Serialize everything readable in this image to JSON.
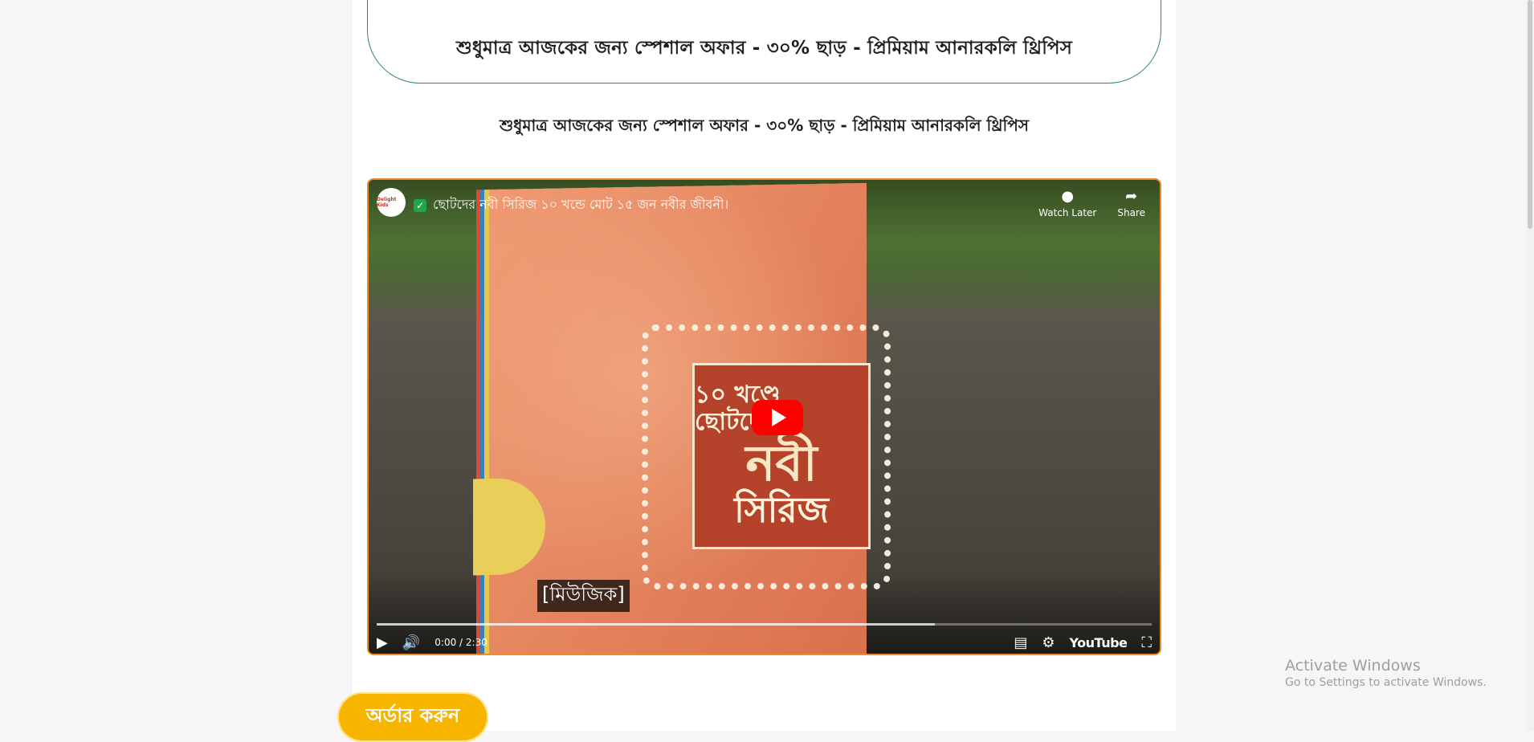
{
  "page": {
    "banner_title": "শুধুমাত্র আজকের জন্য স্পেশাল অফার - ৩০% ছাড় - প্রিমিয়াম আনারকলি থ্রিপিস",
    "subheading": "শুধুমাত্র আজকের জন্য স্পেশাল অফার - ৩০% ছাড় - প্রিমিয়াম আনারকলি থ্রিপিস",
    "order_button": "অর্ডার করুন"
  },
  "video": {
    "channel_logo": "Delight Kids",
    "title": "ছোটদের নবী সিরিজ ১০ খন্ডে মোট ১৫ জন নবীর জীবনী।",
    "watch_later_label": "Watch Later",
    "share_label": "Share",
    "caption": "[মিউজিক]",
    "time": "0:00 / 2:30",
    "buffered_fraction": 0.72,
    "youtube_label": "YouTube",
    "cover_text": {
      "line1": "১০ খণ্ডে ছোটদের",
      "line2": "নবী",
      "line3": "সিরিজ"
    }
  },
  "icons": {
    "play": "play-icon",
    "volume": "volume-icon",
    "subtitles": "subtitles-icon",
    "settings": "gear-icon",
    "fullscreen": "fullscreen-icon",
    "clock": "clock-icon",
    "share": "share-icon"
  },
  "system": {
    "activate_title": "Activate Windows",
    "activate_sub": "Go to Settings to activate Windows."
  },
  "colors": {
    "accent_border": "#f08a24",
    "banner_border": "#2e8b57",
    "order_button": "#f7b500",
    "youtube_red": "#ff0000"
  }
}
